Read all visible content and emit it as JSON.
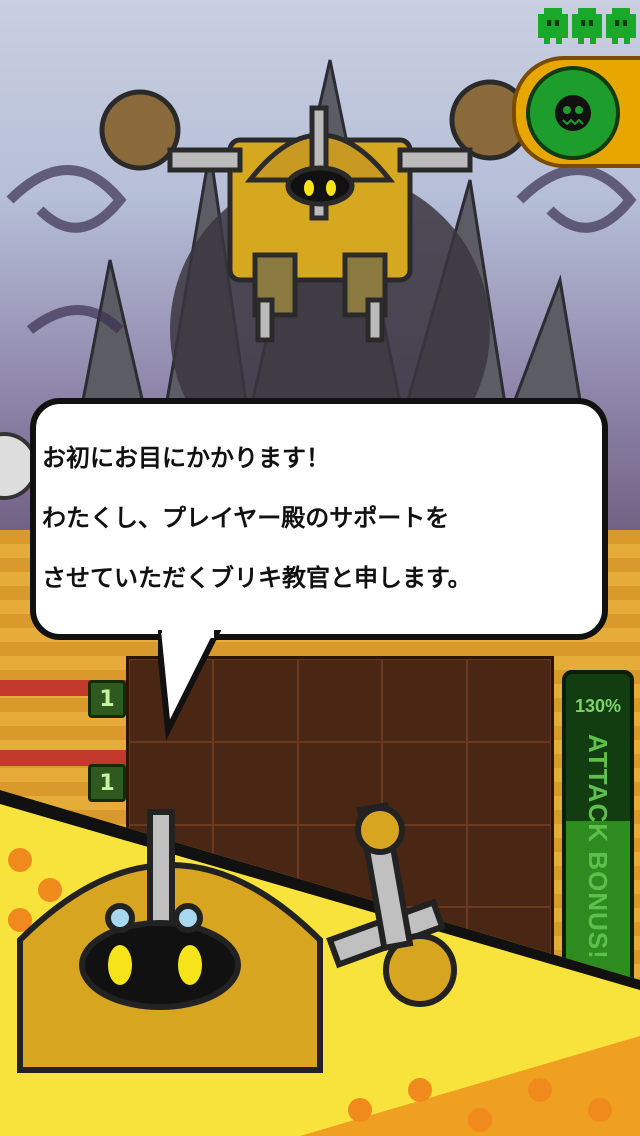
{
  "dialogue": {
    "lines": [
      "お初にお目にかかります！",
      "わたくし、プレイヤー殿のサポートを",
      "させていただくブリキ教官と申します。"
    ]
  },
  "board": {
    "row_badges": [
      "1",
      "1"
    ]
  },
  "attack_bonus": {
    "percent_text": "130%",
    "label": "ATTACK BONUS!",
    "fill_fraction": 0.63
  },
  "hud": {
    "lives_count": 3,
    "boss_gauge_color": "#1d9d2c"
  },
  "colors": {
    "gold": "#d8a520",
    "board_dark": "#4a2614",
    "gauge_green": "#2e8b1f"
  }
}
